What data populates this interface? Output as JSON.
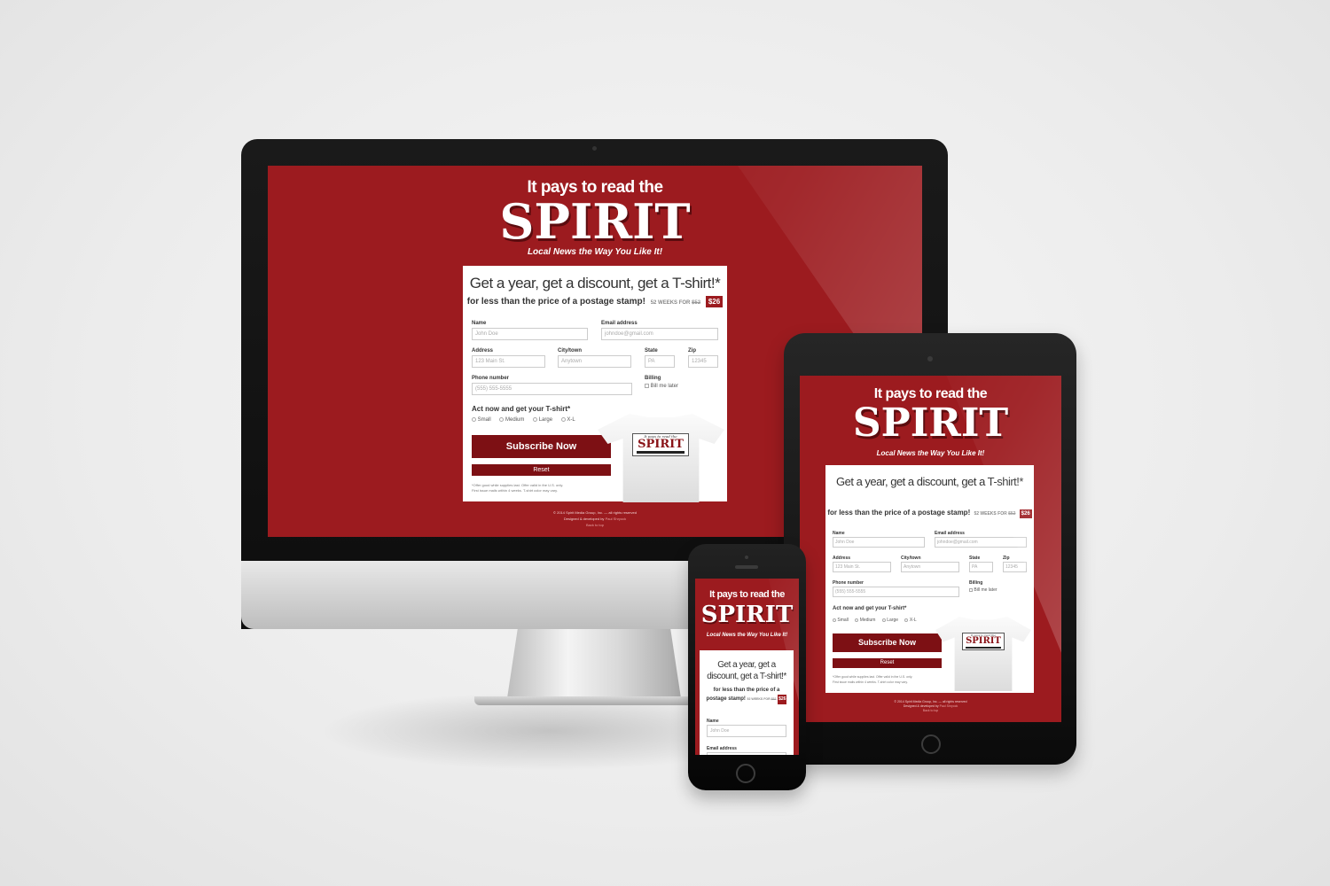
{
  "site": {
    "tagline": "It pays to read the",
    "logo": "SPIRIT",
    "slogan": "Local News the Way You Like It!"
  },
  "offer": {
    "headline": "Get a year, get a discount, get a T-shirt!*",
    "subline": "for less than the price of a postage stamp!",
    "weeks_text": "52 WEEKS FOR",
    "old_price": "$52",
    "new_price": "$26"
  },
  "form": {
    "name_label": "Name",
    "name_placeholder": "John Doe",
    "email_label": "Email address",
    "email_placeholder": "johndoe@gmail.com",
    "address_label": "Address",
    "address_placeholder": "123 Main St.",
    "city_label": "City/town",
    "city_placeholder": "Anytown",
    "state_label": "State",
    "state_placeholder": "PA",
    "zip_label": "Zip",
    "zip_placeholder": "12345",
    "phone_label": "Phone number",
    "phone_placeholder": "(555) 555-5555",
    "billing_label": "Billing",
    "billing_option": "Bill me later",
    "tshirt_label": "Act now and get your T-shirt*",
    "sizes": [
      "Small",
      "Medium",
      "Large",
      "X-L"
    ],
    "subscribe_label": "Subscribe Now",
    "reset_label": "Reset",
    "fineprint_1": "*Offer good while supplies last. Offer valid in the U.S. only.",
    "fineprint_2": "First issue mails within 4 weeks. T-shirt color may vary."
  },
  "tshirt_print": {
    "tag": "It pays to read the",
    "logo": "SPIRIT"
  },
  "footer": {
    "copyright": "© 2014 Spirit Media Group, Inc. — all rights reserved",
    "designed_by": "Designed & developed by",
    "designer": "Paul Shryock",
    "back_to_top": "Back to top"
  },
  "colors": {
    "brand_red": "#9c1b1f",
    "button_red": "#7d1014",
    "background": "#ececec"
  }
}
